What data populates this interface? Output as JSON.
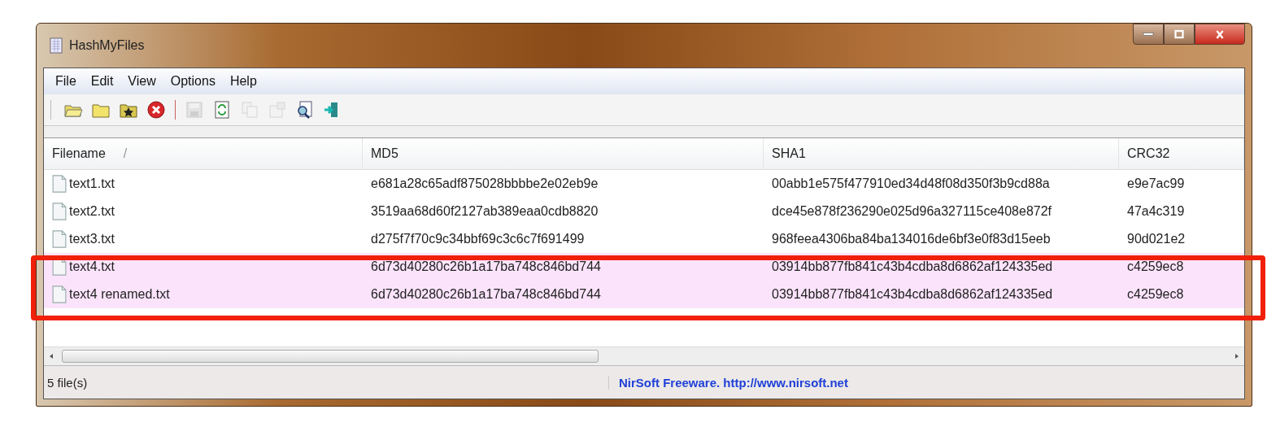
{
  "window": {
    "title": "HashMyFiles"
  },
  "menu": [
    "File",
    "Edit",
    "View",
    "Options",
    "Help"
  ],
  "toolbar": [
    {
      "kind": "open-file",
      "disabled": false
    },
    {
      "kind": "folder",
      "disabled": false
    },
    {
      "kind": "star-folder",
      "disabled": false
    },
    {
      "kind": "delete",
      "disabled": false
    },
    {
      "kind": "separator"
    },
    {
      "kind": "save",
      "disabled": true
    },
    {
      "kind": "refresh",
      "disabled": false
    },
    {
      "kind": "copy",
      "disabled": true
    },
    {
      "kind": "properties",
      "disabled": true
    },
    {
      "kind": "find",
      "disabled": false
    },
    {
      "kind": "exit",
      "disabled": false
    }
  ],
  "table": {
    "columns": [
      {
        "label": "Filename",
        "sort": "/"
      },
      {
        "label": "MD5"
      },
      {
        "label": "SHA1"
      },
      {
        "label": "CRC32"
      }
    ],
    "rows": [
      {
        "filename": "text1.txt",
        "md5": "e681a28c65adf875028bbbbe2e02eb9e",
        "sha1": "00abb1e575f477910ed34d48f08d350f3b9cd88a",
        "crc32": "e9e7ac99",
        "selected": false
      },
      {
        "filename": "text2.txt",
        "md5": "3519aa68d60f2127ab389eaa0cdb8820",
        "sha1": "dce45e878f236290e025d96a327115ce408e872f",
        "crc32": "47a4c319",
        "selected": false
      },
      {
        "filename": "text3.txt",
        "md5": "d275f7f70c9c34bbf69c3c6c7f691499",
        "sha1": "968feea4306ba84ba134016de6bf3e0f83d15eeb",
        "crc32": "90d021e2",
        "selected": false
      },
      {
        "filename": "text4.txt",
        "md5": "6d73d40280c26b1a17ba748c846bd744",
        "sha1": "03914bb877fb841c43b4cdba8d6862af124335ed",
        "crc32": "c4259ec8",
        "selected": true
      },
      {
        "filename": "text4 renamed.txt",
        "md5": "6d73d40280c26b1a17ba748c846bd744",
        "sha1": "03914bb877fb841c43b4cdba8d6862af124335ed",
        "crc32": "c4259ec8",
        "selected": true
      }
    ]
  },
  "status_bar": {
    "count": "5 file(s)",
    "credit": "NirSoft Freeware.  http://www.nirsoft.net"
  }
}
